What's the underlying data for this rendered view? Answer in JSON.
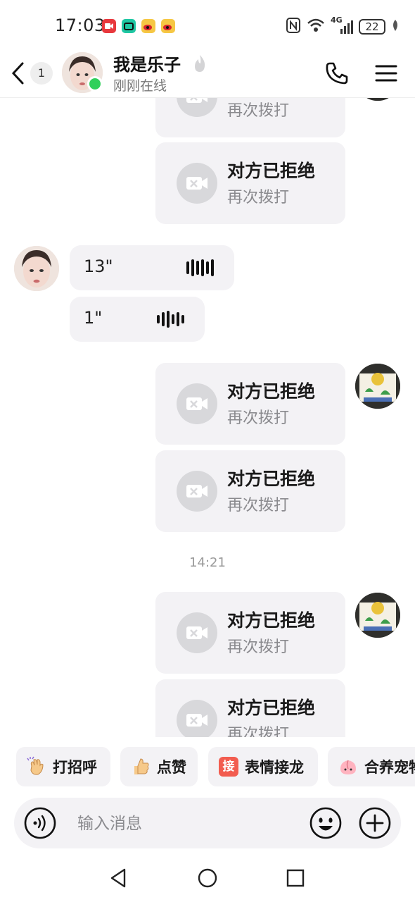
{
  "status_bar": {
    "time": "17:03",
    "network": "4G",
    "battery": "22"
  },
  "header": {
    "unread_count": "1",
    "contact_name": "我是乐子",
    "contact_status": "刚刚在线"
  },
  "messages": {
    "rejected_title": "对方已拒绝",
    "redial_label": "再次拨打",
    "voice_1_duration": "13\"",
    "voice_2_duration": "1\"",
    "timestamp": "14:21"
  },
  "quick_replies": [
    {
      "label": "打招呼",
      "icon": "waving-hand-icon"
    },
    {
      "label": "点赞",
      "icon": "thumbs-up-icon"
    },
    {
      "label": "表情接龙",
      "icon": "jie-badge-icon",
      "badge": "接"
    },
    {
      "label": "合养宠物",
      "icon": "peach-pet-icon"
    }
  ],
  "input": {
    "placeholder": "输入消息",
    "value": ""
  },
  "colors": {
    "online": "#2fd05a",
    "bubble": "#f3f2f5",
    "jie_badge": "#f25c4f"
  }
}
